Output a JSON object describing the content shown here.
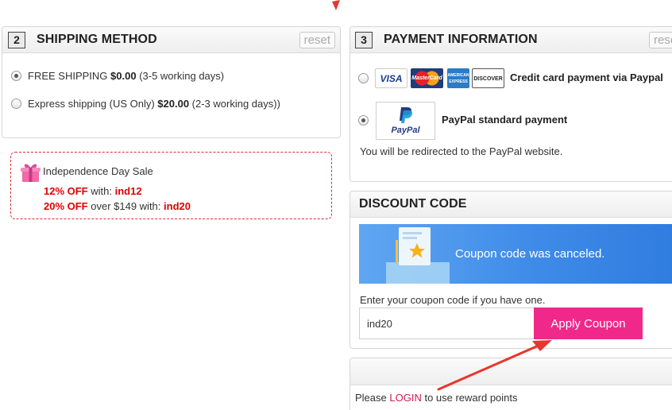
{
  "shipping": {
    "step": "2",
    "title": "SHIPPING METHOD",
    "reset_label": "reset",
    "options": [
      {
        "label": "FREE SHIPPING ",
        "price": "$0.00",
        "note": " (3-5 working days)",
        "selected": true
      },
      {
        "label": "Express shipping (US Only) ",
        "price": "$20.00",
        "note": " (2-3 working days))",
        "selected": false
      }
    ]
  },
  "promo": {
    "title": "Independence Day Sale",
    "line1": {
      "off": "12% OFF",
      "mid": " with: ",
      "code": "ind12"
    },
    "line2": {
      "off": "20% OFF",
      "mid": " over $149 with: ",
      "code": "ind20"
    }
  },
  "payment": {
    "step": "3",
    "title": "PAYMENT INFORMATION",
    "reset_label": "rese",
    "cards": [
      "VISA",
      "MasterCard",
      "AMERICAN EXPRESS",
      "DISCOVER"
    ],
    "credit_label": "Credit card payment via Paypal",
    "paypal_logo_text": "PayPal",
    "paypal_label": "PayPal standard payment",
    "redirect_note": "You will be redirected to the PayPal website.",
    "selected": "paypal"
  },
  "discount": {
    "title": "DISCOUNT CODE",
    "banner_message": "Coupon code was canceled.",
    "prompt": "Enter your coupon code if you have one.",
    "input_value": "ind20",
    "apply_label": "Apply Coupon"
  },
  "reward": {
    "prefix": "Please ",
    "login_label": "LOGIN",
    "suffix": " to use reward points"
  },
  "colors": {
    "apply_button": "#f0288a",
    "banner": "#3f8be8",
    "sale_red": "#e00000",
    "annotation_arrow": "#e8352d",
    "login_link": "#d1195a"
  }
}
